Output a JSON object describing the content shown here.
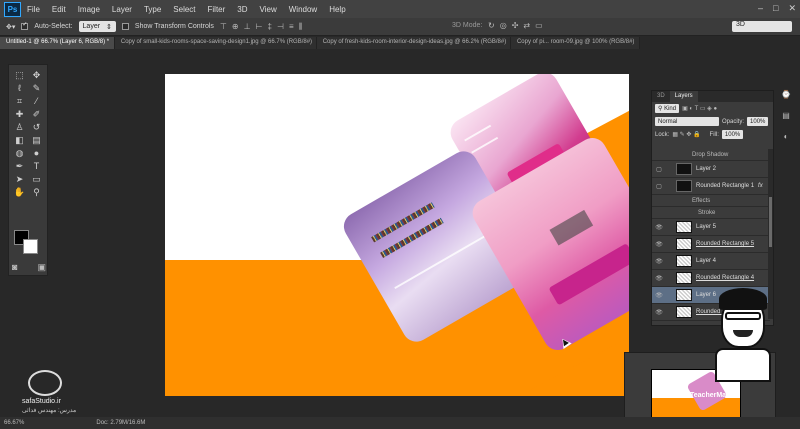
{
  "menubar": {
    "logo": "Ps",
    "items": [
      "File",
      "Edit",
      "Image",
      "Layer",
      "Type",
      "Select",
      "Filter",
      "3D",
      "View",
      "Window",
      "Help"
    ]
  },
  "options": {
    "auto_select_label": "Auto-Select:",
    "auto_select_value": "Layer",
    "show_transform_label": "Show Transform Controls",
    "mode_3d_label": "3D Mode:",
    "workspace_value": "3D"
  },
  "tabs": [
    "Untitled-1 @ 66.7% (Layer 6, RGB/8) *",
    "Copy of small-kids-rooms-space-saving-design1.jpg @ 66.7% (RGB/8#)",
    "Copy of fresh-kids-room-interior-design-ideas.jpg @ 66.2% (RGB/8#)",
    "Copy of pi... room-09.jpg @ 100% (RGB/8#)"
  ],
  "layers_panel": {
    "tab_3d": "3D",
    "tab_layers": "Layers",
    "kind_label": "Kind",
    "blend_mode": "Normal",
    "opacity_label": "Opacity:",
    "opacity_value": "100%",
    "lock_label": "Lock:",
    "fill_label": "Fill:",
    "fill_value": "100%",
    "layers": [
      {
        "name": "Drop Shadow",
        "type": "effect"
      },
      {
        "name": "Layer 2",
        "type": "layer"
      },
      {
        "name": "Rounded Rectangle 1",
        "type": "shape",
        "fx": "fx"
      },
      {
        "name": "Effects",
        "type": "effect"
      },
      {
        "name": "Stroke",
        "type": "effect"
      },
      {
        "name": "Layer 5",
        "type": "layer"
      },
      {
        "name": "Rounded Rectangle 5",
        "type": "shape"
      },
      {
        "name": "Layer 4",
        "type": "layer"
      },
      {
        "name": "Rounded Rectangle 4",
        "type": "shape"
      },
      {
        "name": "Layer 6",
        "type": "layer",
        "selected": true
      },
      {
        "name": "Rounded Rec...",
        "type": "shape"
      }
    ]
  },
  "status": {
    "zoom": "66.67%",
    "doc": "Doc: 2.79M/16.6M"
  },
  "watermark": {
    "site": "safaStudio.ir",
    "sub": "مدرس: مهندس فدائی"
  },
  "avatar_text": "www.TeacherMan.ir",
  "colors": {
    "accent_orange": "#ff9100",
    "ps_blue": "#31a8ff",
    "selected_layer": "#5d6f86"
  }
}
